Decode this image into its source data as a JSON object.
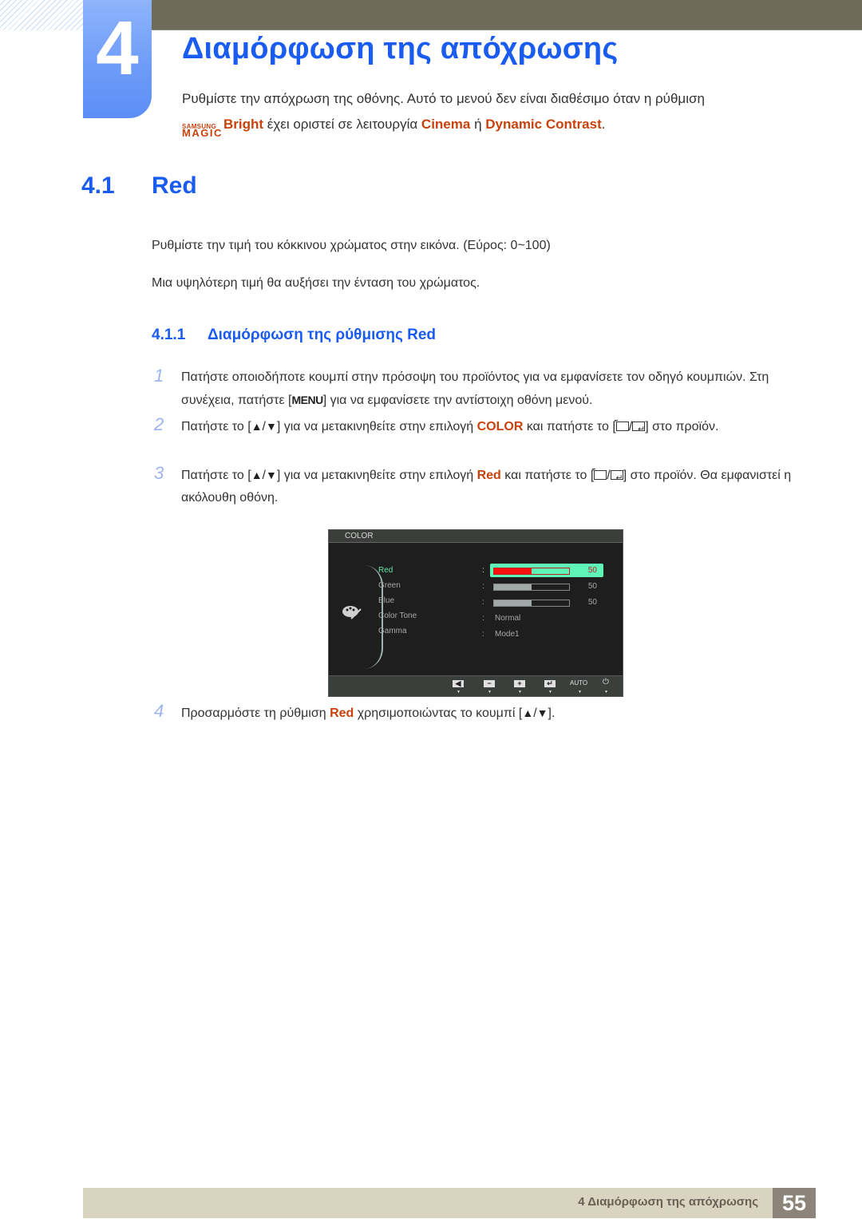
{
  "chapter": {
    "number": "4",
    "title": "Διαμόρφωση της απόχρωσης",
    "intro_line1": "Ρυθμίστε την απόχρωση της οθόνης. Αυτό το μενού δεν είναι διαθέσιμο όταν η ρύθμιση",
    "logo_samsung": "SAMSUNG",
    "logo_magic": "MAGIC",
    "logo_bright": "Bright",
    "intro_mid": " έχει οριστεί σε λειτουργία ",
    "intro_cinema": "Cinema",
    "intro_or": " ή ",
    "intro_dynamic": "Dynamic Contrast",
    "intro_end": "."
  },
  "section": {
    "number": "4.1",
    "title": "Red",
    "para1": "Ρυθμίστε την τιμή του κόκκινου χρώματος στην εικόνα. (Εύρος: 0~100)",
    "para2": "Μια υψηλότερη τιμή θα αυξήσει την ένταση του χρώματος."
  },
  "subsection": {
    "number": "4.1.1",
    "title": "Διαμόρφωση της ρύθμισης Red"
  },
  "steps": [
    {
      "num": "1",
      "a": "Πατήστε οποιοδήποτε κουμπί στην πρόσοψη του προϊόντος για να εμφανίσετε τον οδηγό κουμπιών. Στη συνέχεια, πατήστε [",
      "key": "MENU",
      "b": "] για να εμφανίσετε την αντίστοιχη οθόνη μενού."
    },
    {
      "num": "2",
      "a": "Πατήστε το [",
      "up": "▲",
      "slash": "/",
      "down": "▼",
      "b": "] για να μετακινηθείτε στην επιλογή ",
      "hl": "COLOR",
      "c": " και πατήστε το [",
      "d": "] στο προϊόν."
    },
    {
      "num": "3",
      "a": "Πατήστε το [",
      "up": "▲",
      "slash": "/",
      "down": "▼",
      "b": "] για να μετακινηθείτε στην επιλογή ",
      "hl": "Red",
      "c": " και πατήστε το [",
      "d": "] στο προϊόν. Θα εμφανιστεί η ακόλουθη οθόνη."
    },
    {
      "num": "4",
      "a": "Προσαρμόστε τη ρύθμιση ",
      "hl": "Red",
      "b": " χρησιμοποιώντας το κουμπί [",
      "up": "▲",
      "slash": "/",
      "down": "▼",
      "c": "]."
    }
  ],
  "osd": {
    "header": "COLOR",
    "items": [
      "Red",
      "Green",
      "Blue",
      "Color Tone",
      "Gamma"
    ],
    "active_item": "Red",
    "rows": [
      {
        "type": "bar",
        "value": "50",
        "fraction": 0.5
      },
      {
        "type": "bar",
        "value": "50",
        "fraction": 0.5
      },
      {
        "type": "bar",
        "value": "50",
        "fraction": 0.5
      },
      {
        "type": "text",
        "value": "Normal"
      },
      {
        "type": "text",
        "value": "Mode1"
      }
    ],
    "colon": ":",
    "footer_buttons": [
      "◀",
      "−",
      "+",
      "↵",
      "AUTO",
      "⏻"
    ],
    "arrow": "▼"
  },
  "footer": {
    "title": "4 Διαμόρφωση της απόχρωσης",
    "page": "55"
  }
}
